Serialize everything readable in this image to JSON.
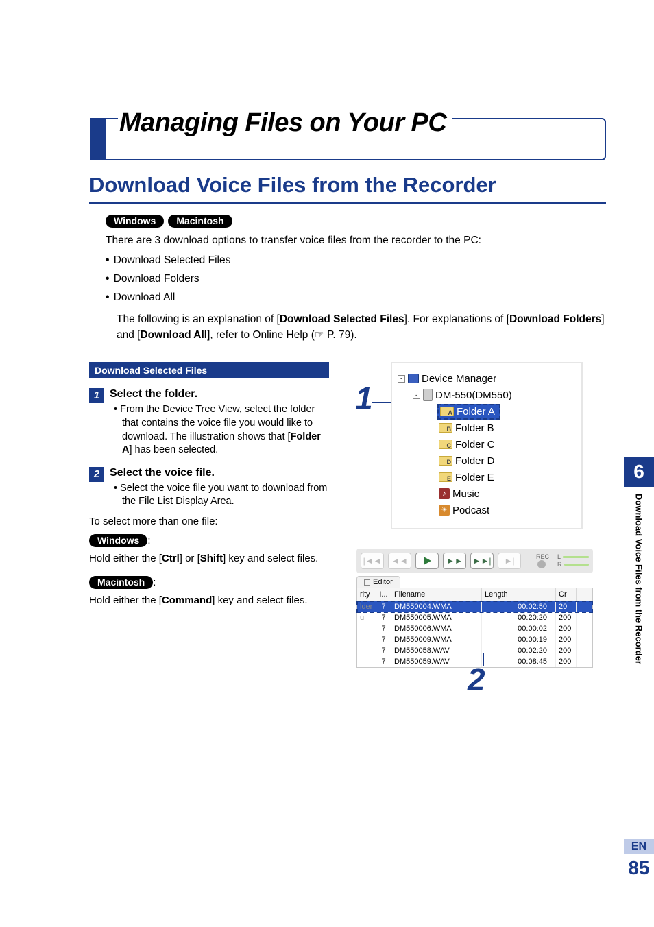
{
  "page_title": "Managing Files on Your PC",
  "section_title": "Download Voice Files from the Recorder",
  "os_badges": {
    "windows": "Windows",
    "macintosh": "Macintosh"
  },
  "intro": "There are 3 download options to transfer voice files from the recorder to the PC:",
  "bullets": [
    "Download Selected Files",
    "Download Folders",
    "Download All"
  ],
  "explain_pre": "The following is an explanation of [",
  "explain_b1": "Download Selected Files",
  "explain_mid1": "]. For explanations of [",
  "explain_b2": "Download Folders",
  "explain_mid2": "] and [",
  "explain_b3": "Download All",
  "explain_post": "], refer to Online Help (☞ P. 79).",
  "blue_bar": "Download Selected Files",
  "steps": {
    "s1": {
      "num": "1",
      "title": "Select the folder.",
      "sub_pre": "From the Device Tree View, select the folder that contains the voice file you would like to download. The illustration shows that [",
      "sub_bold": "Folder A",
      "sub_post": "] has been selected."
    },
    "s2": {
      "num": "2",
      "title": "Select the voice file.",
      "sub": "Select the voice file you want to download from the File List Display Area."
    }
  },
  "more_than_one": "To select more than one file:",
  "win_hold_pre": "Hold either the [",
  "win_hold_b1": "Ctrl",
  "win_hold_mid": "] or [",
  "win_hold_b2": "Shift",
  "win_hold_post": "] key and select files.",
  "mac_hold_pre": "Hold either the [",
  "mac_hold_b1": "Command",
  "mac_hold_post": "] key and select files.",
  "tree": {
    "root": "Device Manager",
    "device": "DM-550(DM550)",
    "folders": [
      "Folder A",
      "Folder B",
      "Folder C",
      "Folder D",
      "Folder E"
    ],
    "letters": [
      "A",
      "B",
      "C",
      "D",
      "E"
    ],
    "music": "Music",
    "podcast": "Podcast"
  },
  "callouts": {
    "c1": "1",
    "c2": "2"
  },
  "player": {
    "tab": "Editor",
    "rec_label_top": "REC",
    "rec_label_l": "L",
    "rec_label_r": "R"
  },
  "filelist": {
    "head_left1": "rity",
    "head_left2": "lder",
    "head_left3": "u",
    "head_i": "I...",
    "head_fn": "Filename",
    "head_len": "Length",
    "head_cr": "Cr",
    "rows": [
      {
        "i": "7",
        "fn": "DM550004.WMA",
        "len": "00:02:50",
        "cr": "20",
        "sel": true
      },
      {
        "i": "7",
        "fn": "DM550005.WMA",
        "len": "00:20:20",
        "cr": "200",
        "sel": false
      },
      {
        "i": "7",
        "fn": "DM550006.WMA",
        "len": "00:00:02",
        "cr": "200",
        "sel": false
      },
      {
        "i": "7",
        "fn": "DM550009.WMA",
        "len": "00:00:19",
        "cr": "200",
        "sel": false
      },
      {
        "i": "7",
        "fn": "DM550058.WAV",
        "len": "00:02:20",
        "cr": "200",
        "sel": false
      },
      {
        "i": "7",
        "fn": "DM550059.WAV",
        "len": "00:08:45",
        "cr": "200",
        "sel": false
      }
    ]
  },
  "side": {
    "chapter": "6",
    "label": "Download Voice Files from the Recorder",
    "lang": "EN",
    "page": "85"
  }
}
